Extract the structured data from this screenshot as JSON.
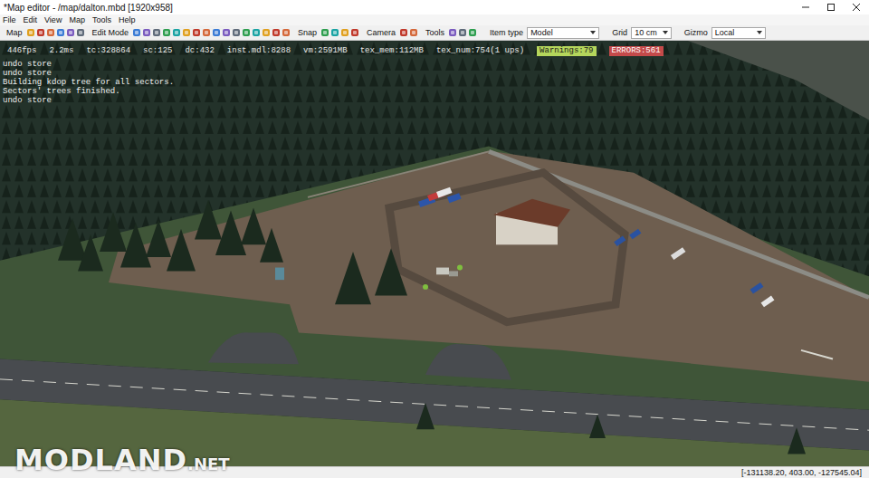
{
  "window": {
    "title": "*Map editor - /map/dalton.mbd [1920x958]"
  },
  "menu": [
    "File",
    "Edit",
    "View",
    "Map",
    "Tools",
    "Help"
  ],
  "toolbar": {
    "labels": [
      "Map",
      "Edit Mode",
      "Snap",
      "Camera",
      "Tools"
    ],
    "dropdowns": [
      {
        "label": "Item type",
        "value": "Model"
      },
      {
        "label": "Grid",
        "value": "10 cm"
      },
      {
        "label": "Gizmo",
        "value": "Local"
      }
    ]
  },
  "stats": [
    {
      "text": "446fps"
    },
    {
      "text": "2.2ms"
    },
    {
      "text": "tc:328864"
    },
    {
      "text": "sc:125"
    },
    {
      "text": "dc:432"
    },
    {
      "text": "inst.mdl:8288"
    },
    {
      "text": "vm:2591MB"
    },
    {
      "text": "tex_mem:112MB"
    },
    {
      "text": "tex_num:754(1 ups)"
    },
    {
      "text": "Warnings:79",
      "color": "#b5d65c"
    },
    {
      "text": "ERRORS:561",
      "color": "#c44a4a"
    }
  ],
  "console": [
    "undo store",
    "undo store",
    "Building kdop tree for all sectors.",
    "Sectors' trees finished.",
    "undo store"
  ],
  "status_bar": {
    "coordinates": "[-131138.20, 403.00, -127545.04]"
  },
  "watermark": {
    "brand": "MODLAND",
    "suffix": ".NET"
  }
}
